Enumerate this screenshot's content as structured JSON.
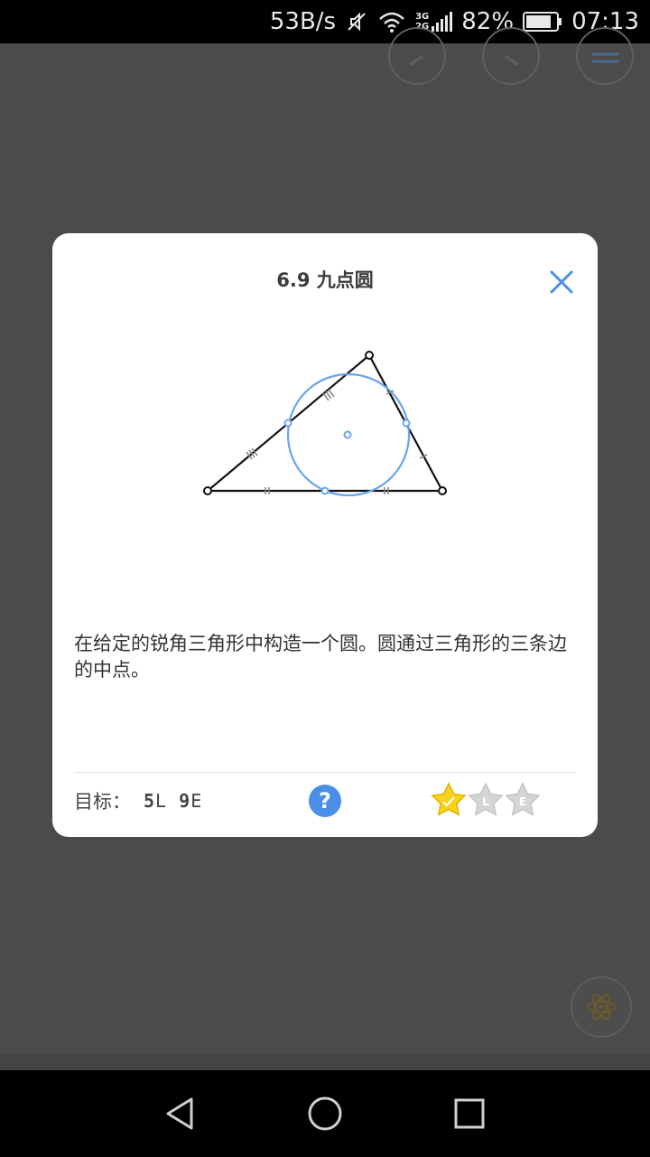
{
  "status_bar": {
    "network_speed": "53B/s",
    "network_type_top": "3G",
    "network_type_bottom": "2G",
    "battery": "82%",
    "time": "07:13"
  },
  "dialog": {
    "title": "6.9 九点圆",
    "description": "在给定的锐角三角形中构造一个圆。圆通过三角形的三条边的中点。",
    "goal_label": "目标：",
    "goal_value": {
      "l_count": "5",
      "l_letter": "L",
      "e_count": "9",
      "e_letter": "E"
    },
    "help_symbol": "?",
    "stars": [
      {
        "state": "earned",
        "mark": "check",
        "color": "#f6d21e"
      },
      {
        "state": "locked",
        "mark": "L",
        "color": "#d5d5d5"
      },
      {
        "state": "locked",
        "mark": "E",
        "color": "#d5d5d5"
      }
    ]
  },
  "colors": {
    "accent": "#4a8fe7",
    "circle": "#6aa3ef",
    "dialog_bg": "#ffffff",
    "dim_bg": "#4a4a4a"
  },
  "icons": {
    "close": "close-icon",
    "help": "question-icon",
    "atom": "atom-icon",
    "back": "back-icon",
    "home": "home-icon",
    "recents": "recents-icon"
  }
}
